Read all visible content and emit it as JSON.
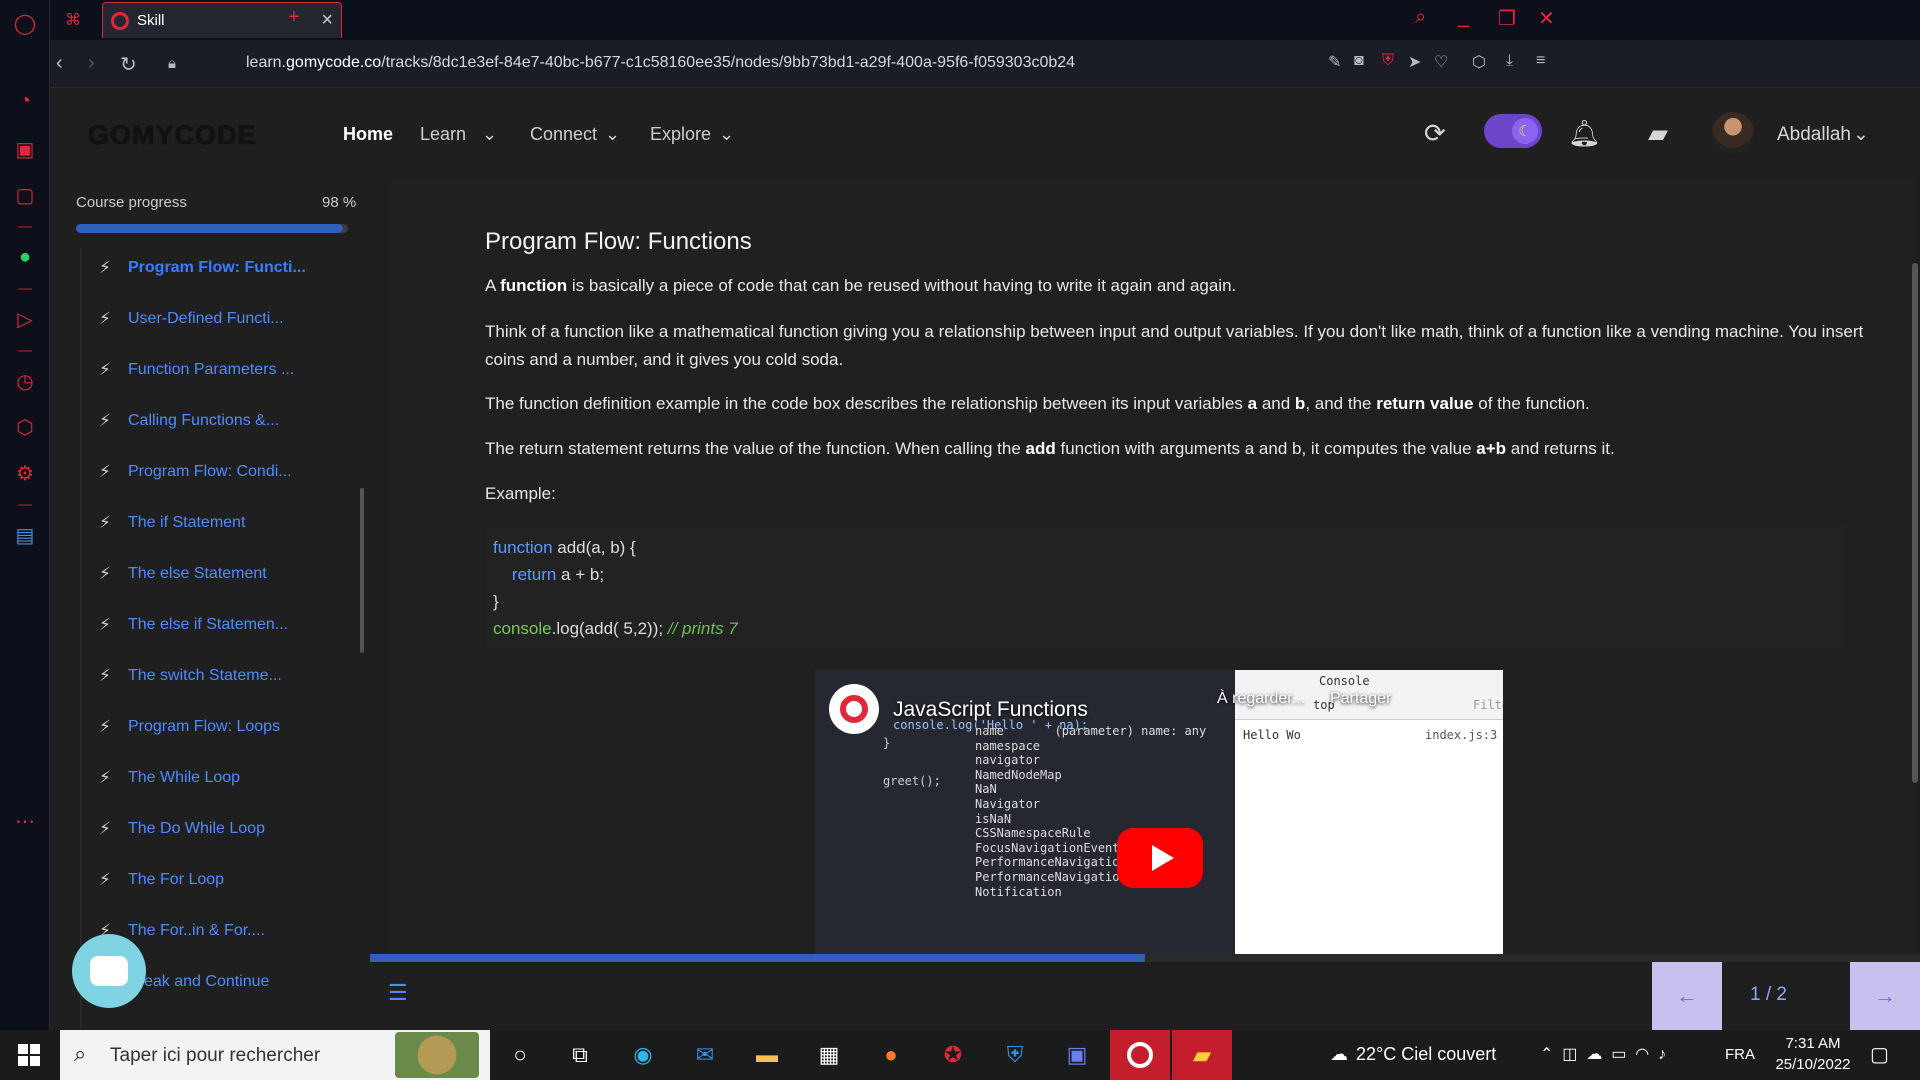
{
  "browser": {
    "tab_title": "Skill",
    "url_prefix": "learn.",
    "url_domain": "gomycode.co",
    "url_path": "/tracks/8dc1e3ef-84e7-40bc-b677-c1c58160ee35/nodes/9bb73bd1-a29f-400a-95f6-f059303c0b24"
  },
  "header": {
    "logo": "GOMYCODE",
    "nav": [
      {
        "label": "Home",
        "active": true
      },
      {
        "label": "Learn"
      },
      {
        "label": "Connect"
      },
      {
        "label": "Explore"
      }
    ],
    "username": "Abdallah"
  },
  "course": {
    "progress_label": "Course progress",
    "progress_pct": "98 %",
    "progress_value": 0.98,
    "lessons": [
      "Program Flow: Functi...",
      "User-Defined Functi...",
      "Function Parameters ...",
      "Calling Functions &...",
      "Program Flow: Condi...",
      "The if Statement",
      "The else Statement",
      "The else if Statemen...",
      "The switch Stateme...",
      "Program Flow: Loops",
      "The While Loop",
      "The Do While Loop",
      "The For Loop",
      "The For..in & For....",
      "Break and Continue"
    ],
    "active_index": 0
  },
  "content": {
    "title": "Program Flow: Functions",
    "p1_a": "A ",
    "p1_b": "function",
    "p1_c": " is basically a piece of code that can be reused without having to write it again and again.",
    "p2": "Think of a function like a mathematical function giving you a relationship between input and output variables. If you don't like math, think of a function like a vending machine. You insert coins and a number, and it gives you cold soda.",
    "p3_a": "The function definition example in the code box describes the relationship between its input variables ",
    "p3_b": "a",
    "p3_c": " and ",
    "p3_d": "b",
    "p3_e": ", and the ",
    "p3_f": "return value",
    "p3_g": " of the function.",
    "p4_a": "The return statement returns the value of the function. When calling the ",
    "p4_b": "add",
    "p4_c": " function with arguments a and b, it computes the value ",
    "p4_d": "a+b",
    "p4_e": " and returns it.",
    "example_label": "Example:",
    "code": {
      "l1_kw": "function",
      "l1_rest": " add(a, b) {",
      "l2_indent": "    ",
      "l2_kw": "return",
      "l2_rest": " a + b;",
      "l3": "}",
      "l4_fn": "console",
      "l4_rest": ".log(add( 5,2)); ",
      "l4_cm": "// prints 7"
    }
  },
  "video": {
    "title": "JavaScript Functions",
    "watch_later": "À regarder...",
    "share": "Partager",
    "editor_lines": [
      "console.log('Hello ' + na);",
      "}",
      "greet();"
    ],
    "autocomplete": [
      "name       (parameter) name: any",
      "namespace",
      "navigator",
      "NamedNodeMap",
      "NaN",
      "Navigator",
      "isNaN",
      "CSSNamespaceRule",
      "FocusNavigationEvent",
      "PerformanceNavigation",
      "PerformanceNavigationTiming",
      "Notification"
    ],
    "devtools_tab": "Console",
    "devtools_context": "top",
    "devtools_filter": "Filter",
    "devtools_output": "Hello Wo",
    "devtools_source": "index.js:3"
  },
  "pager": {
    "indicator": "1 / 2",
    "progress": 0.5
  },
  "taskbar": {
    "search_placeholder": "Taper ici pour rechercher",
    "weather": "22°C  Ciel couvert",
    "lang": "FRA",
    "time": "7:31 AM",
    "date": "25/10/2022"
  }
}
